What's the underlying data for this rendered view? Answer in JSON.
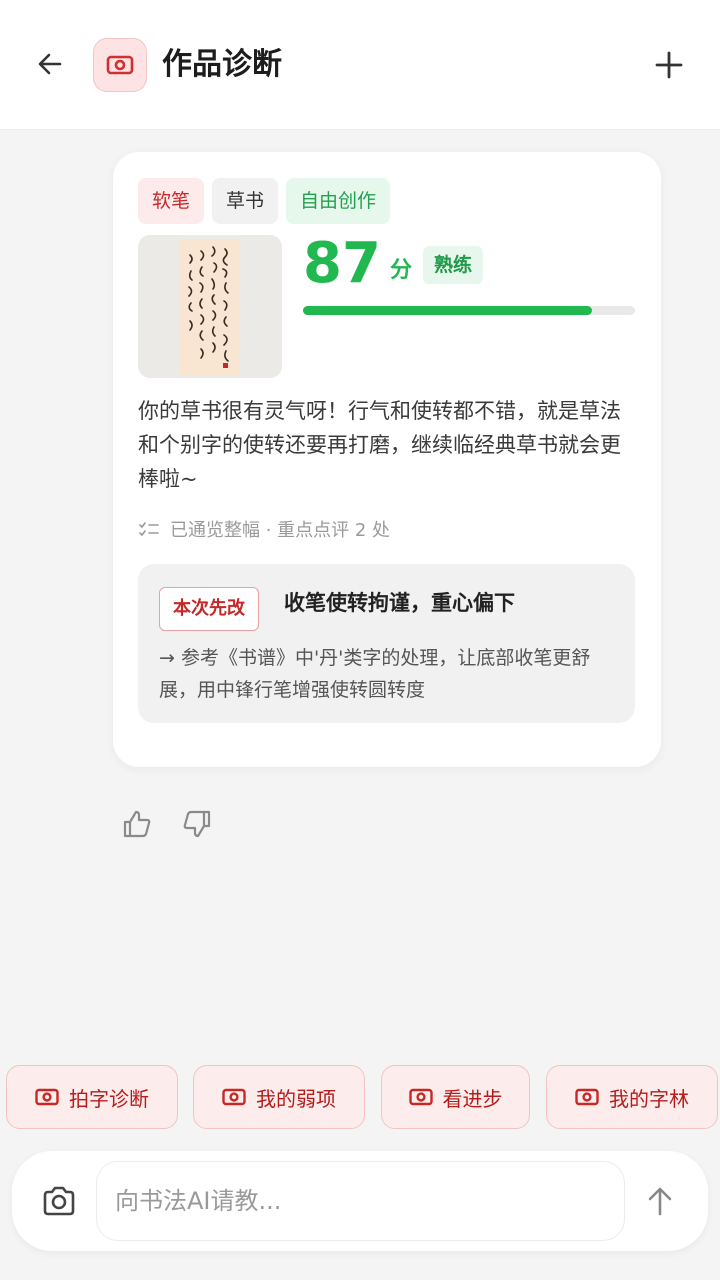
{
  "header": {
    "title": "作品诊断"
  },
  "card": {
    "tags": [
      "软笔",
      "草书",
      "自由创作"
    ],
    "score": "87",
    "score_unit": "分",
    "level": "熟练",
    "score_progress_percent": 87,
    "comment": "你的草书很有灵气呀！行气和使转都不错，就是草法和个别字的使转还要再打磨，继续临经典草书就会更棒啦~",
    "meta": "已通览整幅 · 重点点评 2 处",
    "fix": {
      "badge": "本次先改",
      "title": "收笔使转拘谨，重心偏下",
      "body": "→ 参考《书谱》中'丹'类字的处理，让底部收笔更舒展，用中锋行笔增强使转圆转度"
    }
  },
  "quick_actions": [
    "拍字诊断",
    "我的弱项",
    "看进步",
    "我的字林"
  ],
  "input": {
    "placeholder": "向书法AI请教..."
  },
  "colors": {
    "accent_red": "#c62828",
    "score_green": "#21b84f",
    "chip_bg": "#fdecec"
  },
  "icons": {
    "back": "arrow-left-icon",
    "app": "camera-badge-icon",
    "add": "plus-icon",
    "like": "thumbs-up-icon",
    "dislike": "thumbs-down-icon",
    "camera": "camera-icon",
    "send": "arrow-up-icon",
    "meta": "checklist-icon"
  }
}
